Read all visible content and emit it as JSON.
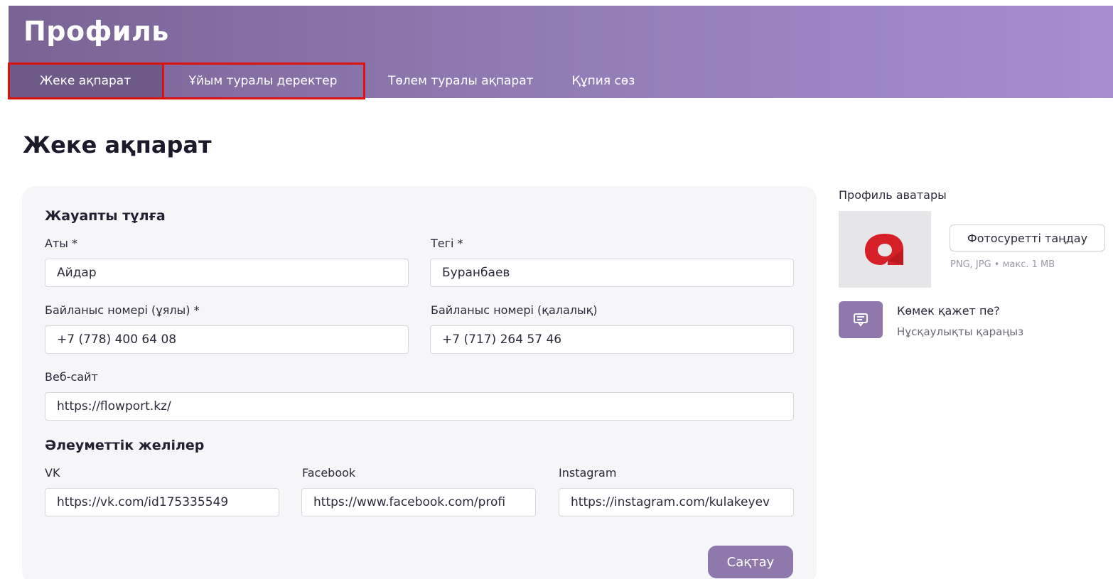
{
  "header": {
    "title": "Профиль",
    "tabs": [
      {
        "label": "Жеке ақпарат",
        "active": true
      },
      {
        "label": "Ұйым туралы деректер",
        "active": false
      },
      {
        "label": "Төлем туралы ақпарат",
        "active": false
      },
      {
        "label": "Құпия сөз",
        "active": false
      }
    ],
    "banner_colors": [
      "#7a6394",
      "#a58ed1"
    ],
    "highlight_color": "#e01010"
  },
  "page_title": "Жеке ақпарат",
  "form": {
    "responsible_group": "Жауапты тұлға",
    "first_name": {
      "label": "Аты *",
      "value": "Айдар"
    },
    "last_name": {
      "label": "Тегі *",
      "value": "Буранбаев"
    },
    "mobile_phone": {
      "label": "Байланыс номері (ұялы) *",
      "value": "+7 (778) 400 64 08"
    },
    "city_phone": {
      "label": "Байланыс номері (қалалық)",
      "value": "+7 (717) 264 57 46"
    },
    "website": {
      "label": "Веб-сайт",
      "value": "https://flowport.kz/"
    },
    "social_group": "Әлеуметтік желілер",
    "vk": {
      "label": "VK",
      "value": "https://vk.com/id175335549"
    },
    "facebook": {
      "label": "Facebook",
      "value": "https://www.facebook.com/profi"
    },
    "instagram": {
      "label": "Instagram",
      "value": "https://instagram.com/kulakeyev"
    },
    "save_label": "Сақтау",
    "accent_color": "#8f79ac"
  },
  "sidebar": {
    "avatar_label": "Профиль аватары",
    "choose_photo_label": "Фотосуретті таңдау",
    "hint": "PNG, JPG • макс. 1 MB",
    "help_title": "Көмек қажет пе?",
    "help_link": "Нұсқаулықты қараңыз",
    "logo_color": "#d61f26",
    "icons": {
      "logo": "brand-logo-icon",
      "help": "chat-icon"
    }
  }
}
